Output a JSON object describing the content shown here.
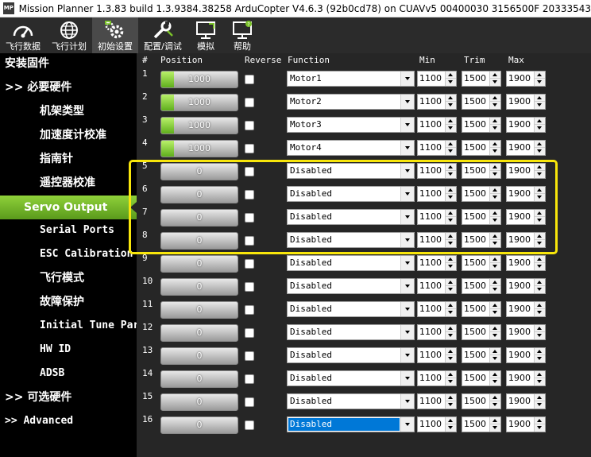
{
  "window": {
    "icon_text": "MP",
    "title": "Mission Planner 1.3.83 build 1.3.9384.38258 ArduCopter V4.6.3 (92b0cd78) on CUAVv5 00400030 3156500F 20333543"
  },
  "toolbar": {
    "items": [
      {
        "label": "飞行数据",
        "icon": "gauge-icon"
      },
      {
        "label": "飞行计划",
        "icon": "globe-icon"
      },
      {
        "label": "初始设置",
        "icon": "gears-icon"
      },
      {
        "label": "配置/调试",
        "icon": "wrench-icon"
      },
      {
        "label": "模拟",
        "icon": "monitor-icon"
      },
      {
        "label": "帮助",
        "icon": "help-monitor-icon"
      }
    ]
  },
  "sidebar": {
    "items": [
      {
        "label": "安装固件"
      },
      {
        "label": ">> 必要硬件"
      },
      {
        "label": "机架类型"
      },
      {
        "label": "加速度计校准"
      },
      {
        "label": "指南针"
      },
      {
        "label": "遥控器校准"
      },
      {
        "label": "Servo Output"
      },
      {
        "label": "Serial Ports"
      },
      {
        "label": "ESC Calibration"
      },
      {
        "label": "飞行模式"
      },
      {
        "label": "故障保护"
      },
      {
        "label": "Initial Tune Parameters"
      },
      {
        "label": "HW ID"
      },
      {
        "label": "ADSB"
      },
      {
        "label": ">> 可选硬件"
      },
      {
        "label": ">> Advanced"
      }
    ]
  },
  "grid": {
    "headers": {
      "num": "#",
      "position": "Position",
      "reverse": "Reverse",
      "function": "Function",
      "min": "Min",
      "trim": "Trim",
      "max": "Max"
    },
    "rows": [
      {
        "num": "1",
        "position": "1000",
        "fill": 0.4,
        "function": "Motor1",
        "min": "1100",
        "trim": "1500",
        "max": "1900"
      },
      {
        "num": "2",
        "position": "1000",
        "fill": 0.4,
        "function": "Motor2",
        "min": "1100",
        "trim": "1500",
        "max": "1900"
      },
      {
        "num": "3",
        "position": "1000",
        "fill": 0.4,
        "function": "Motor3",
        "min": "1100",
        "trim": "1500",
        "max": "1900"
      },
      {
        "num": "4",
        "position": "1000",
        "fill": 0.4,
        "function": "Motor4",
        "min": "1100",
        "trim": "1500",
        "max": "1900"
      },
      {
        "num": "5",
        "position": "0",
        "fill": 0,
        "function": "Disabled",
        "min": "1100",
        "trim": "1500",
        "max": "1900"
      },
      {
        "num": "6",
        "position": "0",
        "fill": 0,
        "function": "Disabled",
        "min": "1100",
        "trim": "1500",
        "max": "1900"
      },
      {
        "num": "7",
        "position": "0",
        "fill": 0,
        "function": "Disabled",
        "min": "1100",
        "trim": "1500",
        "max": "1900"
      },
      {
        "num": "8",
        "position": "0",
        "fill": 0,
        "function": "Disabled",
        "min": "1100",
        "trim": "1500",
        "max": "1900"
      },
      {
        "num": "9",
        "position": "0",
        "fill": 0,
        "function": "Disabled",
        "min": "1100",
        "trim": "1500",
        "max": "1900"
      },
      {
        "num": "10",
        "position": "0",
        "fill": 0,
        "function": "Disabled",
        "min": "1100",
        "trim": "1500",
        "max": "1900"
      },
      {
        "num": "11",
        "position": "0",
        "fill": 0,
        "function": "Disabled",
        "min": "1100",
        "trim": "1500",
        "max": "1900"
      },
      {
        "num": "12",
        "position": "0",
        "fill": 0,
        "function": "Disabled",
        "min": "1100",
        "trim": "1500",
        "max": "1900"
      },
      {
        "num": "13",
        "position": "0",
        "fill": 0,
        "function": "Disabled",
        "min": "1100",
        "trim": "1500",
        "max": "1900"
      },
      {
        "num": "14",
        "position": "0",
        "fill": 0,
        "function": "Disabled",
        "min": "1100",
        "trim": "1500",
        "max": "1900"
      },
      {
        "num": "15",
        "position": "0",
        "fill": 0,
        "function": "Disabled",
        "min": "1100",
        "trim": "1500",
        "max": "1900"
      },
      {
        "num": "16",
        "position": "0",
        "fill": 0,
        "function": "Disabled",
        "min": "1100",
        "trim": "1500",
        "max": "1900",
        "selected": true
      }
    ]
  },
  "colors": {
    "active_green": "#7bc32a",
    "highlight_yellow": "#f8e60b",
    "selection_blue": "#0078d7"
  }
}
